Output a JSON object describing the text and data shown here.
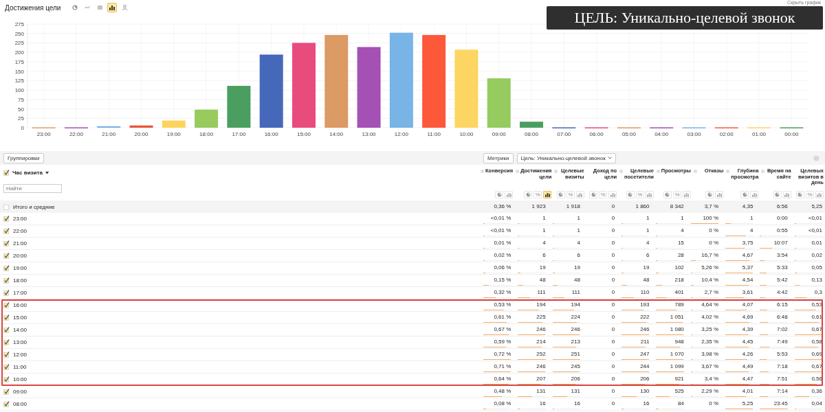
{
  "header": {
    "title": "Достижения цели",
    "chart_types": [
      {
        "kind": "pie",
        "selected": false
      },
      {
        "kind": "line",
        "selected": false
      },
      {
        "kind": "list",
        "selected": false
      },
      {
        "kind": "bar",
        "selected": true
      },
      {
        "kind": "person",
        "selected": false
      }
    ],
    "hide_chart": "Скрыть график"
  },
  "overlay": {
    "caption": "ЦЕЛЬ: Уникально-целевой звонок"
  },
  "chart": {
    "chart_data": {
      "type": "bar",
      "categories": [
        "23:00",
        "22:00",
        "21:00",
        "20:00",
        "19:00",
        "18:00",
        "17:00",
        "16:00",
        "15:00",
        "14:00",
        "13:00",
        "12:00",
        "11:00",
        "10:00",
        "09:00",
        "08:00",
        "07:00",
        "06:00",
        "05:00",
        "04:00",
        "03:00",
        "02:00",
        "01:00",
        "00:00"
      ],
      "series": [
        {
          "values": [
            1,
            1,
            4,
            6,
            19,
            48,
            111,
            194,
            225,
            246,
            214,
            252,
            246,
            207,
            131,
            16,
            1,
            1,
            1,
            1,
            1,
            1,
            1,
            1
          ],
          "colors": [
            "#dfa06c",
            "#a553b6",
            "#78b3e4",
            "#e9553a",
            "#fdd35e",
            "#97cb5e",
            "#4a9f60",
            "#4668bb",
            "#e84c7d",
            "#dc9a64",
            "#a450b5",
            "#78b4e6",
            "#fd583a",
            "#fdd562",
            "#96cb5f",
            "#4a9f60",
            "#4668bb",
            "#e84c7d",
            "#dc9a64",
            "#a450b5",
            "#78b4e6",
            "#fd583a",
            "#fdd562",
            "#4a9f60"
          ]
        }
      ],
      "ylim": [
        0,
        275
      ],
      "grid": true,
      "yticks": [
        0,
        25,
        50,
        75,
        100,
        125,
        150,
        175,
        200,
        225,
        250,
        275
      ]
    }
  },
  "toolbar": {
    "groupings": "Группировки",
    "metrics": "Метрики",
    "goal": "Цель: Уникально-целевой звонок"
  },
  "table": {
    "dimension": {
      "label": "Час визита",
      "checked": true,
      "search_placeholder": "Найти"
    },
    "columns": [
      {
        "label": "Конверсия",
        "marker": true,
        "buttons": [
          {
            "kind": "pie",
            "selected": false
          },
          {
            "kind": "bar",
            "selected": false
          }
        ]
      },
      {
        "label": "Достижения цели",
        "marker": true,
        "buttons": [
          {
            "kind": "pie",
            "selected": false
          },
          {
            "kind": "percent",
            "label": "%",
            "selected": false
          },
          {
            "kind": "bar",
            "selected": true
          }
        ]
      },
      {
        "label": "Целевые визиты",
        "marker": true,
        "buttons": [
          {
            "kind": "pie",
            "selected": false
          },
          {
            "kind": "percent",
            "label": "%",
            "selected": false
          },
          {
            "kind": "bar",
            "selected": false
          }
        ]
      },
      {
        "label": "Доход по цели",
        "marker": false,
        "buttons": [
          {
            "kind": "pie",
            "selected": false
          },
          {
            "kind": "percent",
            "label": "%",
            "selected": false
          },
          {
            "kind": "bar",
            "selected": false
          }
        ]
      },
      {
        "label": "Целевые посетители",
        "marker": true,
        "buttons": [
          {
            "kind": "pie",
            "selected": false
          },
          {
            "kind": "percent",
            "label": "%",
            "selected": false
          },
          {
            "kind": "bar",
            "selected": false
          }
        ]
      },
      {
        "label": "Просмотры",
        "marker": true,
        "buttons": [
          {
            "kind": "pie",
            "selected": false
          },
          {
            "kind": "percent",
            "label": "%",
            "selected": false
          },
          {
            "kind": "bar",
            "selected": false
          }
        ]
      },
      {
        "label": "Отказы",
        "marker": true,
        "buttons": [
          {
            "kind": "pie",
            "selected": false
          },
          {
            "kind": "bar",
            "selected": false
          }
        ]
      },
      {
        "label": "Глубина просмотра",
        "marker": true,
        "buttons": [
          {
            "kind": "pie",
            "selected": false
          },
          {
            "kind": "bar",
            "selected": false
          }
        ]
      },
      {
        "label": "Время на сайте",
        "marker": true,
        "buttons": [
          {
            "kind": "pie",
            "selected": false
          },
          {
            "kind": "bar",
            "selected": false
          }
        ]
      },
      {
        "label": "Целевых визитов в день",
        "marker": false,
        "buttons": [
          {
            "kind": "pie",
            "selected": false
          },
          {
            "kind": "percent",
            "label": "%",
            "selected": false
          },
          {
            "kind": "bar",
            "selected": false
          }
        ]
      }
    ],
    "totals": {
      "label": "Итого и средние",
      "checked": false,
      "cells": [
        "0,36 %",
        "1 923",
        "1 918",
        "0",
        "1 860",
        "8 342",
        "3,7 %",
        "4,35",
        "6:56",
        "5,25"
      ]
    },
    "rows": [
      {
        "label": "23:00",
        "checked": true,
        "highlighted": false,
        "cells": [
          {
            "text": "<0,01 %",
            "level": 0.01
          },
          {
            "text": "1",
            "level": 0.01
          },
          {
            "text": "1",
            "level": 0.01
          },
          {
            "text": "0"
          },
          {
            "text": "1",
            "level": 0.01
          },
          {
            "text": "1",
            "level": 0.01
          },
          {
            "text": "100 %",
            "level": 1
          },
          {
            "text": "1",
            "level": 0.19
          },
          {
            "text": "0:00"
          },
          {
            "text": "<0,01",
            "level": 0.01
          }
        ]
      },
      {
        "label": "22:00",
        "checked": true,
        "highlighted": false,
        "cells": [
          {
            "text": "<0,01 %",
            "level": 0.01
          },
          {
            "text": "1",
            "level": 0.01
          },
          {
            "text": "1",
            "level": 0.01
          },
          {
            "text": "0"
          },
          {
            "text": "1",
            "level": 0.01
          },
          {
            "text": "4",
            "level": 0.01
          },
          {
            "text": "0 %"
          },
          {
            "text": "4",
            "level": 0.74
          },
          {
            "text": "0:55",
            "level": 0.04
          },
          {
            "text": "<0,01",
            "level": 0.01
          }
        ]
      },
      {
        "label": "21:00",
        "checked": true,
        "highlighted": false,
        "cells": [
          {
            "text": "0,01 %",
            "level": 0.01
          },
          {
            "text": "4",
            "level": 0.02
          },
          {
            "text": "4",
            "level": 0.02
          },
          {
            "text": "0"
          },
          {
            "text": "4",
            "level": 0.02
          },
          {
            "text": "15",
            "level": 0.01
          },
          {
            "text": "0 %"
          },
          {
            "text": "3,75",
            "level": 0.7
          },
          {
            "text": "10:07",
            "level": 0.43
          },
          {
            "text": "0,01",
            "level": 0.01
          }
        ]
      },
      {
        "label": "20:00",
        "checked": true,
        "highlighted": false,
        "cells": [
          {
            "text": "0,02 %",
            "level": 0.03
          },
          {
            "text": "6",
            "level": 0.02
          },
          {
            "text": "6",
            "level": 0.02
          },
          {
            "text": "0"
          },
          {
            "text": "6",
            "level": 0.02
          },
          {
            "text": "28",
            "level": 0.03
          },
          {
            "text": "16,7 %",
            "level": 0.17
          },
          {
            "text": "4,67",
            "level": 0.87
          },
          {
            "text": "3:54",
            "level": 0.16
          },
          {
            "text": "0,02",
            "level": 0.03
          }
        ]
      },
      {
        "label": "19:00",
        "checked": true,
        "highlighted": false,
        "cells": [
          {
            "text": "0,06 %",
            "level": 0.08
          },
          {
            "text": "19",
            "level": 0.08
          },
          {
            "text": "19",
            "level": 0.08
          },
          {
            "text": "0"
          },
          {
            "text": "19",
            "level": 0.08
          },
          {
            "text": "102",
            "level": 0.09
          },
          {
            "text": "5,26 %",
            "level": 0.05
          },
          {
            "text": "5,37",
            "level": 1
          },
          {
            "text": "5:33",
            "level": 0.23
          },
          {
            "text": "0,05",
            "level": 0.07
          }
        ]
      },
      {
        "label": "18:00",
        "checked": true,
        "highlighted": false,
        "cells": [
          {
            "text": "0,15 %",
            "level": 0.21
          },
          {
            "text": "48",
            "level": 0.19
          },
          {
            "text": "48",
            "level": 0.19
          },
          {
            "text": "0"
          },
          {
            "text": "48",
            "level": 0.19
          },
          {
            "text": "218",
            "level": 0.2
          },
          {
            "text": "10,4 %",
            "level": 0.1
          },
          {
            "text": "4,54",
            "level": 0.85
          },
          {
            "text": "5:42",
            "level": 0.24
          },
          {
            "text": "0,13",
            "level": 0.19
          }
        ]
      },
      {
        "label": "17:00",
        "checked": true,
        "highlighted": false,
        "cells": [
          {
            "text": "0,32 %",
            "level": 0.44
          },
          {
            "text": "111",
            "level": 0.44
          },
          {
            "text": "111",
            "level": 0.44
          },
          {
            "text": "0"
          },
          {
            "text": "110",
            "level": 0.45
          },
          {
            "text": "401",
            "level": 0.36
          },
          {
            "text": "2,7 %",
            "level": 0.03
          },
          {
            "text": "3,61",
            "level": 0.67
          },
          {
            "text": "4:42",
            "level": 0.2
          },
          {
            "text": "0,3",
            "level": 0.43
          }
        ]
      },
      {
        "label": "16:00",
        "checked": true,
        "highlighted": true,
        "cells": [
          {
            "text": "0,53 %",
            "level": 0.74
          },
          {
            "text": "194",
            "level": 0.77
          },
          {
            "text": "194",
            "level": 0.77
          },
          {
            "text": "0"
          },
          {
            "text": "193",
            "level": 0.78
          },
          {
            "text": "789",
            "level": 0.72
          },
          {
            "text": "4,64 %",
            "level": 0.05
          },
          {
            "text": "4,07",
            "level": 0.76
          },
          {
            "text": "6:15",
            "level": 0.26
          },
          {
            "text": "0,53",
            "level": 0.77
          }
        ]
      },
      {
        "label": "15:00",
        "checked": true,
        "highlighted": true,
        "cells": [
          {
            "text": "0,61 %",
            "level": 0.85
          },
          {
            "text": "225",
            "level": 0.89
          },
          {
            "text": "224",
            "level": 0.89
          },
          {
            "text": "0"
          },
          {
            "text": "222",
            "level": 0.9
          },
          {
            "text": "1 051",
            "level": 0.96
          },
          {
            "text": "4,02 %",
            "level": 0.04
          },
          {
            "text": "4,69",
            "level": 0.87
          },
          {
            "text": "6:48",
            "level": 0.29
          },
          {
            "text": "0,61",
            "level": 0.88
          }
        ]
      },
      {
        "label": "14:00",
        "checked": true,
        "highlighted": true,
        "cells": [
          {
            "text": "0,67 %",
            "level": 0.93
          },
          {
            "text": "246",
            "level": 0.98
          },
          {
            "text": "246",
            "level": 0.98
          },
          {
            "text": "0"
          },
          {
            "text": "246",
            "level": 1
          },
          {
            "text": "1 080",
            "level": 0.98
          },
          {
            "text": "3,25 %",
            "level": 0.03
          },
          {
            "text": "4,39",
            "level": 0.82
          },
          {
            "text": "7:02",
            "level": 0.3
          },
          {
            "text": "0,67",
            "level": 0.97
          }
        ]
      },
      {
        "label": "13:00",
        "checked": true,
        "highlighted": true,
        "cells": [
          {
            "text": "0,59 %",
            "level": 0.82
          },
          {
            "text": "214",
            "level": 0.85
          },
          {
            "text": "213",
            "level": 0.85
          },
          {
            "text": "0"
          },
          {
            "text": "211",
            "level": 0.85
          },
          {
            "text": "948",
            "level": 0.86
          },
          {
            "text": "2,35 %",
            "level": 0.02
          },
          {
            "text": "4,45",
            "level": 0.83
          },
          {
            "text": "7:49",
            "level": 0.33
          },
          {
            "text": "0,58",
            "level": 0.84
          }
        ]
      },
      {
        "label": "12:00",
        "checked": true,
        "highlighted": true,
        "cells": [
          {
            "text": "0,72 %",
            "level": 1
          },
          {
            "text": "252",
            "level": 1
          },
          {
            "text": "251",
            "level": 1
          },
          {
            "text": "0"
          },
          {
            "text": "247",
            "level": 1
          },
          {
            "text": "1 070",
            "level": 0.97
          },
          {
            "text": "3,98 %",
            "level": 0.04
          },
          {
            "text": "4,26",
            "level": 0.79
          },
          {
            "text": "5:53",
            "level": 0.25
          },
          {
            "text": "0,69",
            "level": 1
          }
        ]
      },
      {
        "label": "11:00",
        "checked": true,
        "highlighted": true,
        "cells": [
          {
            "text": "0,71 %",
            "level": 0.99
          },
          {
            "text": "246",
            "level": 0.98
          },
          {
            "text": "245",
            "level": 0.98
          },
          {
            "text": "0"
          },
          {
            "text": "244",
            "level": 0.99
          },
          {
            "text": "1 099",
            "level": 1
          },
          {
            "text": "3,67 %",
            "level": 0.04
          },
          {
            "text": "4,49",
            "level": 0.84
          },
          {
            "text": "7:18",
            "level": 0.31
          },
          {
            "text": "0,67",
            "level": 0.97
          }
        ]
      },
      {
        "label": "10:00",
        "checked": true,
        "highlighted": true,
        "cells": [
          {
            "text": "0,64 %",
            "level": 0.89
          },
          {
            "text": "207",
            "level": 0.82
          },
          {
            "text": "206",
            "level": 0.82
          },
          {
            "text": "0"
          },
          {
            "text": "206",
            "level": 0.83
          },
          {
            "text": "921",
            "level": 0.84
          },
          {
            "text": "3,4 %",
            "level": 0.03
          },
          {
            "text": "4,47",
            "level": 0.83
          },
          {
            "text": "7:51",
            "level": 0.33
          },
          {
            "text": "0,56",
            "level": 0.81
          }
        ]
      },
      {
        "label": "09:00",
        "checked": true,
        "highlighted": false,
        "cells": [
          {
            "text": "0,48 %",
            "level": 0.67
          },
          {
            "text": "131",
            "level": 0.52
          },
          {
            "text": "131",
            "level": 0.52
          },
          {
            "text": "0"
          },
          {
            "text": "130",
            "level": 0.53
          },
          {
            "text": "525",
            "level": 0.48
          },
          {
            "text": "2,29 %",
            "level": 0.02
          },
          {
            "text": "4,01",
            "level": 0.75
          },
          {
            "text": "7:14",
            "level": 0.3
          },
          {
            "text": "0,36",
            "level": 0.52
          }
        ]
      },
      {
        "label": "08:00",
        "checked": true,
        "highlighted": false,
        "cells": [
          {
            "text": "0,08 %",
            "level": 0.11
          },
          {
            "text": "16",
            "level": 0.06
          },
          {
            "text": "16",
            "level": 0.06
          },
          {
            "text": "0"
          },
          {
            "text": "16",
            "level": 0.06
          },
          {
            "text": "84",
            "level": 0.08
          },
          {
            "text": "0 %"
          },
          {
            "text": "5,25",
            "level": 0.98
          },
          {
            "text": "23:45",
            "level": 1
          },
          {
            "text": "0,04",
            "level": 0.06
          }
        ]
      }
    ]
  }
}
